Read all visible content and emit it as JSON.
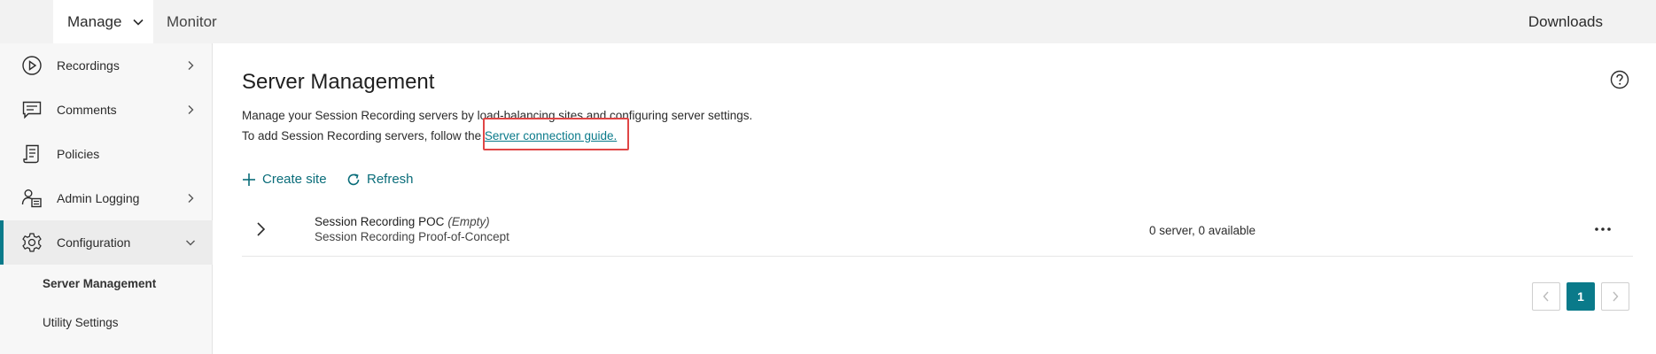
{
  "topbar": {
    "tabs": [
      {
        "label": "Manage"
      },
      {
        "label": "Monitor"
      }
    ],
    "downloads_label": "Downloads"
  },
  "sidebar": {
    "items": [
      {
        "label": "Recordings",
        "icon": "play-circle-icon"
      },
      {
        "label": "Comments",
        "icon": "comment-icon"
      },
      {
        "label": "Policies",
        "icon": "document-icon"
      },
      {
        "label": "Admin Logging",
        "icon": "user-log-icon"
      },
      {
        "label": "Configuration",
        "icon": "gear-icon"
      }
    ],
    "subitems": [
      {
        "label": "Server Management"
      },
      {
        "label": "Utility Settings"
      }
    ]
  },
  "main": {
    "title": "Server Management",
    "description_line1": "Manage your Session Recording servers by load-balancing sites and configuring server settings.",
    "description_line2_prefix": "To add Session Recording servers, follow the",
    "description_link": "Server connection guide.",
    "create_site_label": "Create site",
    "refresh_label": "Refresh",
    "sites": [
      {
        "name": "Session Recording POC",
        "status": "(Empty)",
        "description": "Session Recording Proof-of-Concept",
        "server_count": "0 server, 0 available"
      }
    ],
    "pagination": {
      "current_page": "1"
    }
  },
  "colors": {
    "accent": "#0a7a8a",
    "highlight": "#e04646"
  }
}
